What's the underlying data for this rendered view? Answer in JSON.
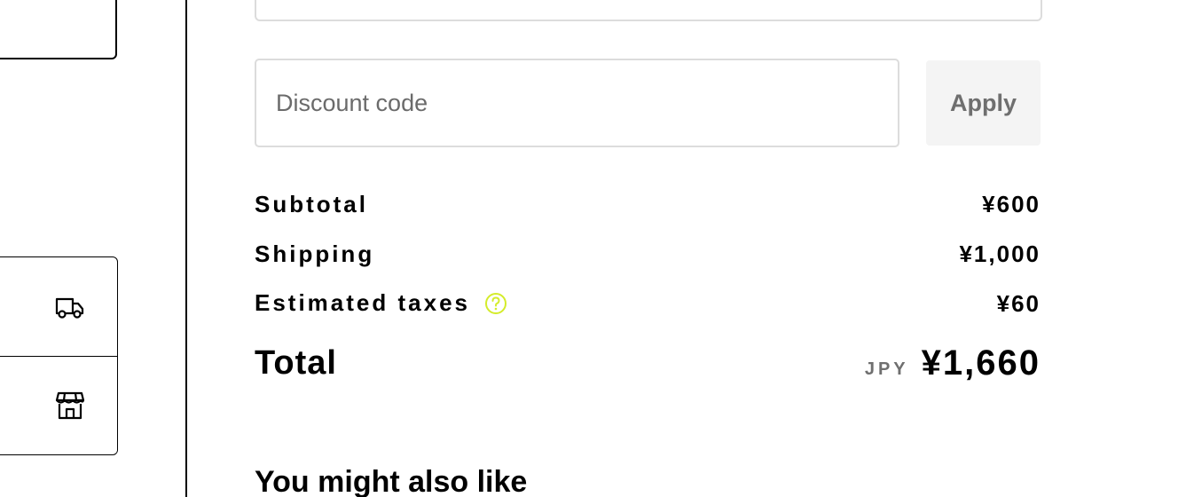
{
  "discount": {
    "placeholder": "Discount code",
    "apply_label": "Apply"
  },
  "summary": {
    "subtotal_label": "Subtotal",
    "subtotal_value": "¥600",
    "shipping_label": "Shipping",
    "shipping_value": "¥1,000",
    "taxes_label": "Estimated taxes",
    "taxes_value": "¥60",
    "total_label": "Total",
    "total_currency": "JPY",
    "total_value": "¥1,660"
  },
  "recommendations": {
    "heading": "You might also like"
  },
  "icons": {
    "delivery": "truck-icon",
    "pickup": "store-icon",
    "help": "question-circle-icon"
  },
  "colors": {
    "help_accent": "#d4ec2a",
    "muted_text": "#6f6f6f",
    "field_border": "#dcdcdc",
    "apply_bg": "#f4f4f4"
  }
}
